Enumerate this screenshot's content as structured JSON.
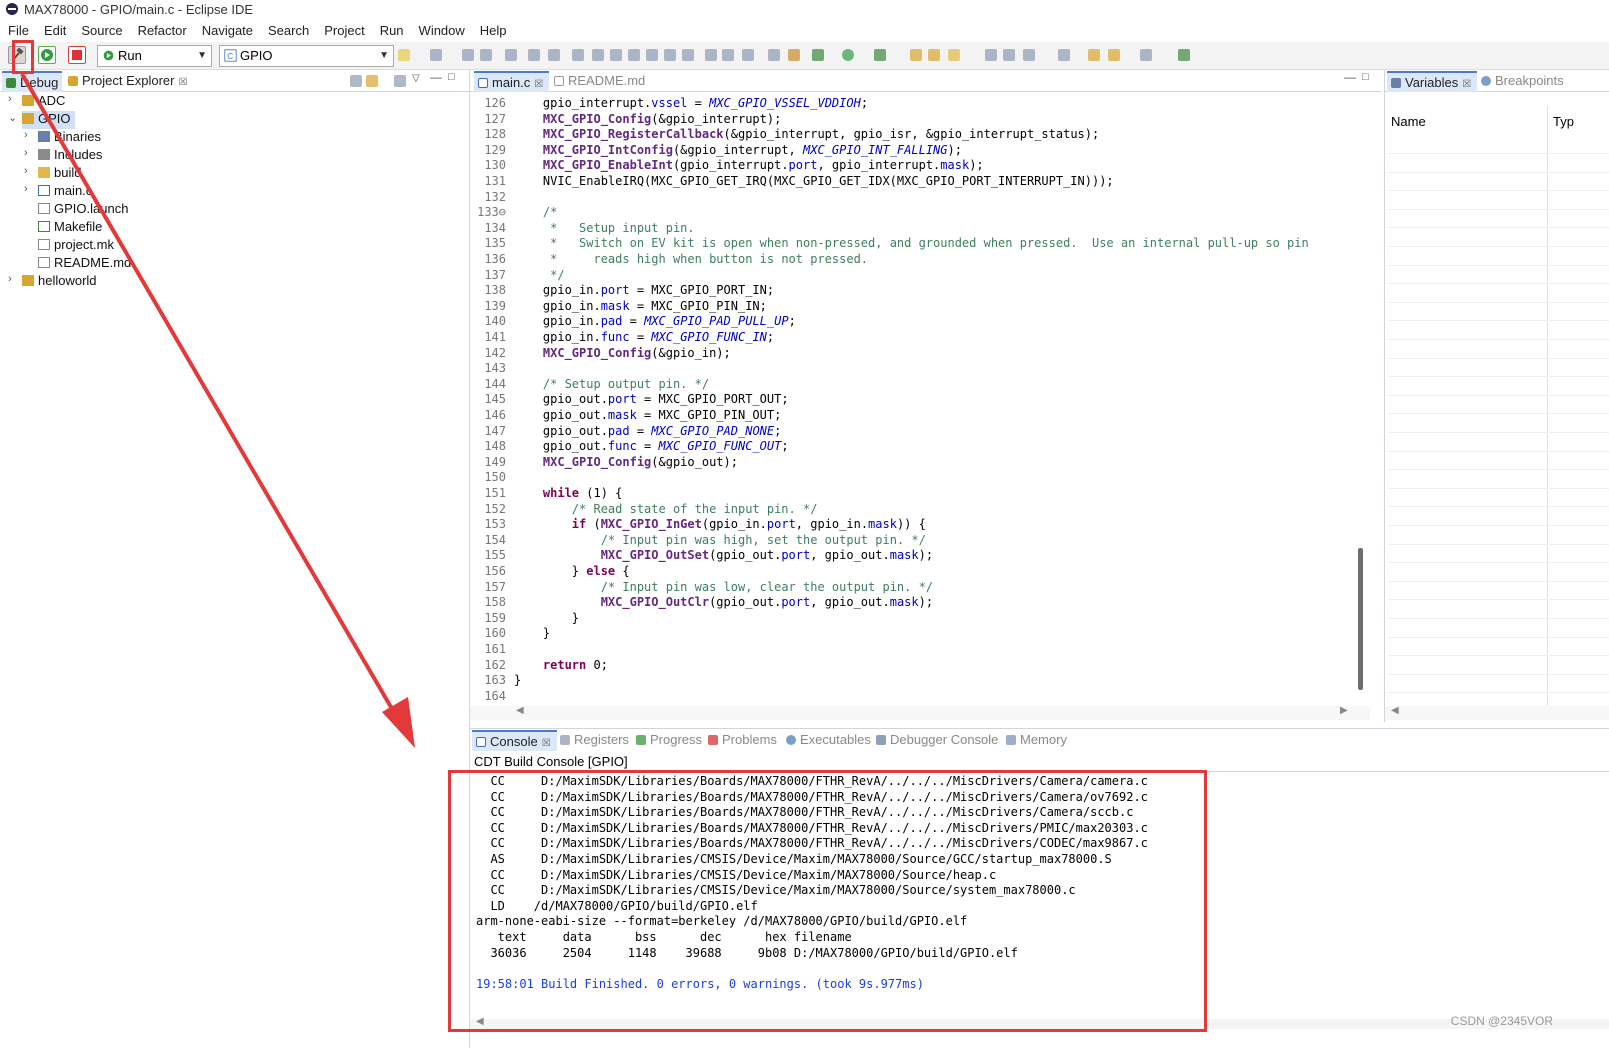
{
  "window": {
    "title": "MAX78000 - GPIO/main.c - Eclipse IDE"
  },
  "menu": [
    "File",
    "Edit",
    "Source",
    "Refactor",
    "Navigate",
    "Search",
    "Project",
    "Run",
    "Window",
    "Help"
  ],
  "toolbar": {
    "launch_mode": "Run",
    "launch_config": "GPIO"
  },
  "left_panel": {
    "tabs": [
      {
        "label": "Debug",
        "active": true
      },
      {
        "label": "Project Explorer",
        "active": false,
        "closable": true
      }
    ],
    "tree": [
      {
        "label": "ADC",
        "depth": 0,
        "expanded": false,
        "icon": "project-folder-icon"
      },
      {
        "label": "GPIO",
        "depth": 0,
        "expanded": true,
        "selected": true,
        "icon": "project-folder-icon"
      },
      {
        "label": "Binaries",
        "depth": 1,
        "expanded": false,
        "icon": "binaries-icon"
      },
      {
        "label": "Includes",
        "depth": 1,
        "expanded": false,
        "icon": "includes-icon"
      },
      {
        "label": "build",
        "depth": 1,
        "expanded": false,
        "icon": "folder-icon"
      },
      {
        "label": "main.c",
        "depth": 1,
        "expanded": false,
        "icon": "c-file-icon"
      },
      {
        "label": "GPIO.launch",
        "depth": 1,
        "icon": "launch-file-icon"
      },
      {
        "label": "Makefile",
        "depth": 1,
        "icon": "makefile-icon"
      },
      {
        "label": "project.mk",
        "depth": 1,
        "icon": "file-icon"
      },
      {
        "label": "README.md",
        "depth": 1,
        "icon": "file-icon"
      },
      {
        "label": "helloworld",
        "depth": 0,
        "expanded": false,
        "icon": "project-folder-icon"
      }
    ]
  },
  "editor": {
    "tabs": [
      {
        "label": "main.c",
        "active": true
      },
      {
        "label": "README.md",
        "active": false
      }
    ],
    "lines": [
      {
        "n": "126",
        "html": "    gpio_interrupt.<span class=\"fld\">vssel</span> = <span class=\"cst\">MXC_GPIO_VSSEL_VDDIOH</span>;"
      },
      {
        "n": "127",
        "html": "    <span class=\"fn\">MXC_GPIO_Config</span>(&amp;gpio_interrupt);"
      },
      {
        "n": "128",
        "html": "    <span class=\"fn\">MXC_GPIO_RegisterCallback</span>(&amp;gpio_interrupt, gpio_isr, &amp;gpio_interrupt_status);"
      },
      {
        "n": "129",
        "html": "    <span class=\"fn\">MXC_GPIO_IntConfig</span>(&amp;gpio_interrupt, <span class=\"cst\">MXC_GPIO_INT_FALLING</span>);"
      },
      {
        "n": "130",
        "html": "    <span class=\"fn\">MXC_GPIO_EnableInt</span>(gpio_interrupt.<span class=\"fld\">port</span>, gpio_interrupt.<span class=\"fld\">mask</span>);"
      },
      {
        "n": "131",
        "html": "    NVIC_EnableIRQ(MXC_GPIO_GET_IRQ(MXC_GPIO_GET_IDX(MXC_GPIO_PORT_INTERRUPT_IN)));"
      },
      {
        "n": "132",
        "html": ""
      },
      {
        "n": "133⊖",
        "html": "    <span class=\"cm\">/*</span>"
      },
      {
        "n": "134",
        "html": "    <span class=\"cm\"> *   Setup input pin.</span>"
      },
      {
        "n": "135",
        "html": "    <span class=\"cm\"> *   Switch on EV kit is open when non-pressed, and grounded when pressed.  Use an internal pull-up so pin</span>"
      },
      {
        "n": "136",
        "html": "    <span class=\"cm\"> *     reads high when button is not pressed.</span>"
      },
      {
        "n": "137",
        "html": "    <span class=\"cm\"> */</span>"
      },
      {
        "n": "138",
        "html": "    gpio_in.<span class=\"fld\">port</span> = MXC_GPIO_PORT_IN;"
      },
      {
        "n": "139",
        "html": "    gpio_in.<span class=\"fld\">mask</span> = MXC_GPIO_PIN_IN;"
      },
      {
        "n": "140",
        "html": "    gpio_in.<span class=\"fld\">pad</span> = <span class=\"cst\">MXC_GPIO_PAD_PULL_UP</span>;"
      },
      {
        "n": "141",
        "html": "    gpio_in.<span class=\"fld\">func</span> = <span class=\"cst\">MXC_GPIO_FUNC_IN</span>;"
      },
      {
        "n": "142",
        "html": "    <span class=\"fn\">MXC_GPIO_Config</span>(&amp;gpio_in);"
      },
      {
        "n": "143",
        "html": ""
      },
      {
        "n": "144",
        "html": "    <span class=\"cm\">/* Setup output pin. */</span>"
      },
      {
        "n": "145",
        "html": "    gpio_out.<span class=\"fld\">port</span> = MXC_GPIO_PORT_OUT;"
      },
      {
        "n": "146",
        "html": "    gpio_out.<span class=\"fld\">mask</span> = MXC_GPIO_PIN_OUT;"
      },
      {
        "n": "147",
        "html": "    gpio_out.<span class=\"fld\">pad</span> = <span class=\"cst\">MXC_GPIO_PAD_NONE</span>;"
      },
      {
        "n": "148",
        "html": "    gpio_out.<span class=\"fld\">func</span> = <span class=\"cst\">MXC_GPIO_FUNC_OUT</span>;"
      },
      {
        "n": "149",
        "html": "    <span class=\"fn\">MXC_GPIO_Config</span>(&amp;gpio_out);"
      },
      {
        "n": "150",
        "html": ""
      },
      {
        "n": "151",
        "html": "    <span class=\"kw\">while</span> (1) {"
      },
      {
        "n": "152",
        "html": "        <span class=\"cm\">/* Read state of the input pin. */</span>"
      },
      {
        "n": "153",
        "html": "        <span class=\"kw\">if</span> (<span class=\"fn\">MXC_GPIO_InGet</span>(gpio_in.<span class=\"fld\">port</span>, gpio_in.<span class=\"fld\">mask</span>)) {"
      },
      {
        "n": "154",
        "html": "            <span class=\"cm\">/* Input pin was high, set the output pin. */</span>"
      },
      {
        "n": "155",
        "html": "            <span class=\"fn\">MXC_GPIO_OutSet</span>(gpio_out.<span class=\"fld\">port</span>, gpio_out.<span class=\"fld\">mask</span>);"
      },
      {
        "n": "156",
        "html": "        } <span class=\"kw\">else</span> {"
      },
      {
        "n": "157",
        "html": "            <span class=\"cm\">/* Input pin was low, clear the output pin. */</span>"
      },
      {
        "n": "158",
        "html": "            <span class=\"fn\">MXC_GPIO_OutClr</span>(gpio_out.<span class=\"fld\">port</span>, gpio_out.<span class=\"fld\">mask</span>);"
      },
      {
        "n": "159",
        "html": "        }"
      },
      {
        "n": "160",
        "html": "    }"
      },
      {
        "n": "161",
        "html": ""
      },
      {
        "n": "162",
        "html": "    <span class=\"kw\">return</span> 0;"
      },
      {
        "n": "163",
        "html": "}"
      },
      {
        "n": "164",
        "html": ""
      }
    ]
  },
  "right_panel": {
    "tabs": [
      {
        "label": "Variables",
        "active": true,
        "closable": true
      },
      {
        "label": "Breakpoints",
        "active": false
      }
    ],
    "columns": [
      "Name",
      "Typ"
    ]
  },
  "bottom_panel": {
    "tabs": [
      {
        "label": "Console",
        "active": true,
        "closable": true
      },
      {
        "label": "Registers"
      },
      {
        "label": "Progress"
      },
      {
        "label": "Problems"
      },
      {
        "label": "Executables"
      },
      {
        "label": "Debugger Console"
      },
      {
        "label": "Memory"
      }
    ],
    "console_title": "CDT Build Console [GPIO]",
    "console_lines": [
      "  CC     D:/MaximSDK/Libraries/Boards/MAX78000/FTHR_RevA/../../../MiscDrivers/Camera/camera.c",
      "  CC     D:/MaximSDK/Libraries/Boards/MAX78000/FTHR_RevA/../../../MiscDrivers/Camera/ov7692.c",
      "  CC     D:/MaximSDK/Libraries/Boards/MAX78000/FTHR_RevA/../../../MiscDrivers/Camera/sccb.c",
      "  CC     D:/MaximSDK/Libraries/Boards/MAX78000/FTHR_RevA/../../../MiscDrivers/PMIC/max20303.c",
      "  CC     D:/MaximSDK/Libraries/Boards/MAX78000/FTHR_RevA/../../../MiscDrivers/CODEC/max9867.c",
      "  AS     D:/MaximSDK/Libraries/CMSIS/Device/Maxim/MAX78000/Source/GCC/startup_max78000.S",
      "  CC     D:/MaximSDK/Libraries/CMSIS/Device/Maxim/MAX78000/Source/heap.c",
      "  CC     D:/MaximSDK/Libraries/CMSIS/Device/Maxim/MAX78000/Source/system_max78000.c",
      "  LD    /d/MAX78000/GPIO/build/GPIO.elf",
      "arm-none-eabi-size --format=berkeley /d/MAX78000/GPIO/build/GPIO.elf",
      "   text     data      bss      dec      hex filename",
      "  36036     2504     1148    39688     9b08 D:/MAX78000/GPIO/build/GPIO.elf",
      "",
      "19:58:01 Build Finished. 0 errors, 0 warnings. (took 9s.977ms)"
    ]
  },
  "watermark": "CSDN @2345VOR",
  "colors": {
    "annotation_red": "#e23a3a",
    "keyword": "#7f0055",
    "comment": "#3f7f5f",
    "field": "#0000c0",
    "build_finished": "#1a3fd6"
  }
}
